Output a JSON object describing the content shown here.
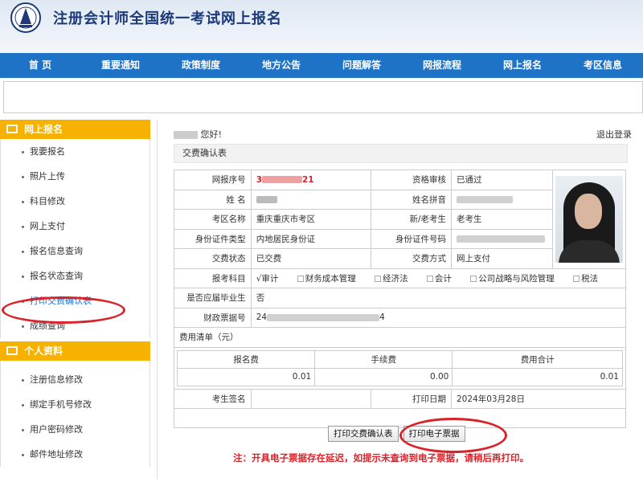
{
  "header": {
    "title": "注册会计师全国统一考试网上报名",
    "logo_icon": "seal-logo-icon"
  },
  "nav": [
    "首 页",
    "重要通知",
    "政策制度",
    "地方公告",
    "问题解答",
    "网报流程",
    "网上报名",
    "考区信息"
  ],
  "sidebar": {
    "section1": {
      "title": "网上报名",
      "items": [
        "我要报名",
        "照片上传",
        "科目修改",
        "网上支付",
        "报名信息查询",
        "报名状态查询",
        "打印交费确认表",
        "成绩查询"
      ]
    },
    "section2": {
      "title": "个人资料",
      "items": [
        "注册信息修改",
        "绑定手机号修改",
        "用户密码修改",
        "邮件地址修改"
      ]
    }
  },
  "main": {
    "greeting": "您好!",
    "logout": "退出登录",
    "section_title": "交费确认表",
    "info": {
      "reg_no_label": "网报序号",
      "reg_no_prefix": "3",
      "reg_no_suffix": "21",
      "review_label": "资格审核",
      "review_value": "已通过",
      "name_label": "姓 名",
      "pinyin_label": "姓名拼音",
      "area_label": "考区名称",
      "area_value": "重庆重庆市考区",
      "newold_label": "新/老考生",
      "newold_value": "老考生",
      "idtype_label": "身份证件类型",
      "idtype_value": "内地居民身份证",
      "idno_label": "身份证件号码",
      "paystatus_label": "交费状态",
      "paystatus_value": "已交费",
      "paymethod_label": "交费方式",
      "paymethod_value": "网上支付",
      "subjects_label": "报考科目",
      "subjects": [
        {
          "name": "审计",
          "checked": true
        },
        {
          "name": "财务成本管理",
          "checked": false
        },
        {
          "name": "经济法",
          "checked": false
        },
        {
          "name": "会计",
          "checked": false
        },
        {
          "name": "公司战略与风险管理",
          "checked": false
        },
        {
          "name": "税法",
          "checked": false
        }
      ],
      "graduate_label": "是否应届毕业生",
      "graduate_value": "否",
      "invoice_label": "财政票据号",
      "invoice_prefix": "24",
      "invoice_suffix": "4",
      "fee_list_label": "费用清单（元）",
      "fee_headers": [
        "报名费",
        "手续费",
        "费用合计"
      ],
      "fee_values": [
        "0.01",
        "0.00",
        "0.01"
      ],
      "sign_label": "考生签名",
      "print_date_label": "打印日期",
      "print_date_value": "2024年03月28日"
    },
    "buttons": {
      "print_confirm": "打印交费确认表",
      "print_receipt": "打印电子票据"
    },
    "note": "注：开具电子票据存在延迟，如提示未查询到电子票据，请稍后再打印。"
  },
  "colors": {
    "nav": "#1f73c7",
    "sidebar_header": "#f7b100",
    "highlight": "#d9232a"
  }
}
